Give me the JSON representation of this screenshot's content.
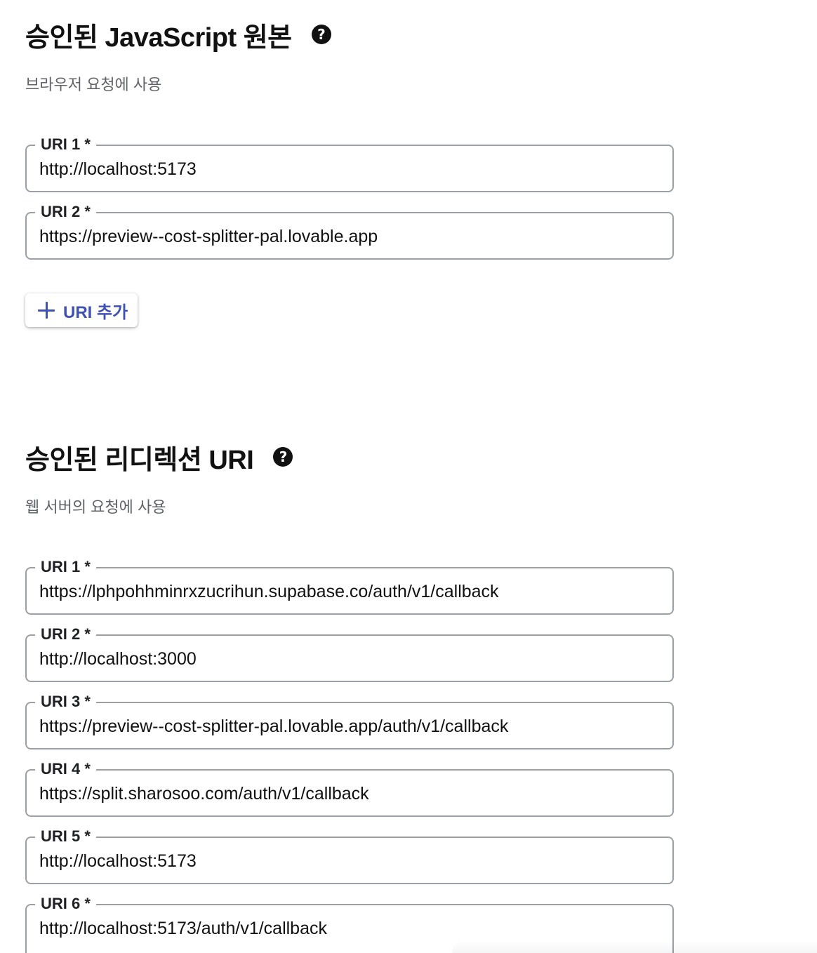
{
  "js_origins": {
    "title": "승인된 JavaScript 원본",
    "help_icon": "help-circle-icon",
    "description": "브라우저 요청에 사용",
    "uris": [
      {
        "label": "URI 1 *",
        "value": "http://localhost:5173"
      },
      {
        "label": "URI 2 *",
        "value": "https://preview--cost-splitter-pal.lovable.app"
      }
    ],
    "add_button_label": "URI 추가",
    "add_icon": "plus-icon"
  },
  "redirect_uris": {
    "title": "승인된 리디렉션 URI",
    "help_icon": "help-circle-icon",
    "description": "웹 서버의 요청에 사용",
    "uris": [
      {
        "label": "URI 1 *",
        "value": "https://lphpohhminrxzucrihun.supabase.co/auth/v1/callback"
      },
      {
        "label": "URI 2 *",
        "value": "http://localhost:3000"
      },
      {
        "label": "URI 3 *",
        "value": "https://preview--cost-splitter-pal.lovable.app/auth/v1/callback"
      },
      {
        "label": "URI 4 *",
        "value": "https://split.sharosoo.com/auth/v1/callback"
      },
      {
        "label": "URI 5 *",
        "value": "http://localhost:5173"
      },
      {
        "label": "URI 6 *",
        "value": "http://localhost:5173/auth/v1/callback"
      }
    ]
  },
  "colors": {
    "accent": "#3f51b5",
    "border": "#9aa0a6",
    "muted_text": "#5f6368"
  }
}
